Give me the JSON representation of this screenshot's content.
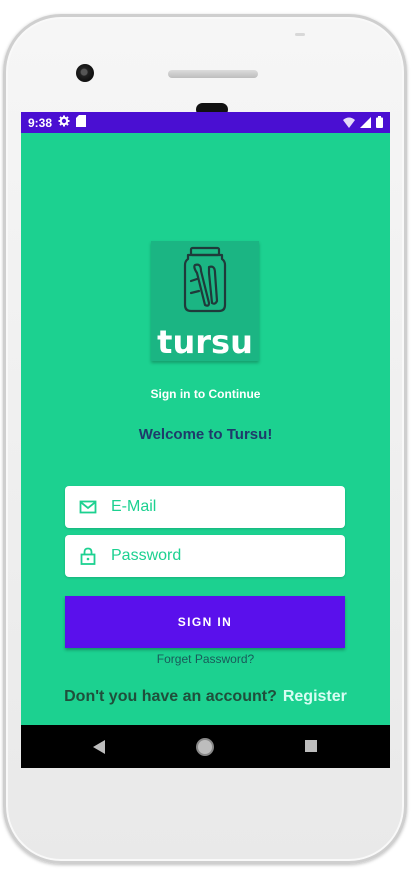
{
  "status": {
    "time": "9:38",
    "left_icons": [
      "gear-icon",
      "sd-card-icon"
    ],
    "right_icons": [
      "wifi-icon",
      "signal-icon",
      "battery-icon"
    ]
  },
  "logo": {
    "text": "tursu",
    "icon": "pickle-jar-icon"
  },
  "captions": {
    "signin": "Sign in to Continue",
    "welcome": "Welcome to Tursu!"
  },
  "form": {
    "email_placeholder": "E-Mail",
    "password_placeholder": "Password",
    "signin_label": "SIGN IN",
    "forget_label": "Forget Password?"
  },
  "account": {
    "question": "Don't you have an account?",
    "register_label": "Register"
  },
  "colors": {
    "background": "#1cd190",
    "statusbar": "#4a0fd2",
    "button": "#5a10ec",
    "welcome_text": "#1f3a6b"
  }
}
